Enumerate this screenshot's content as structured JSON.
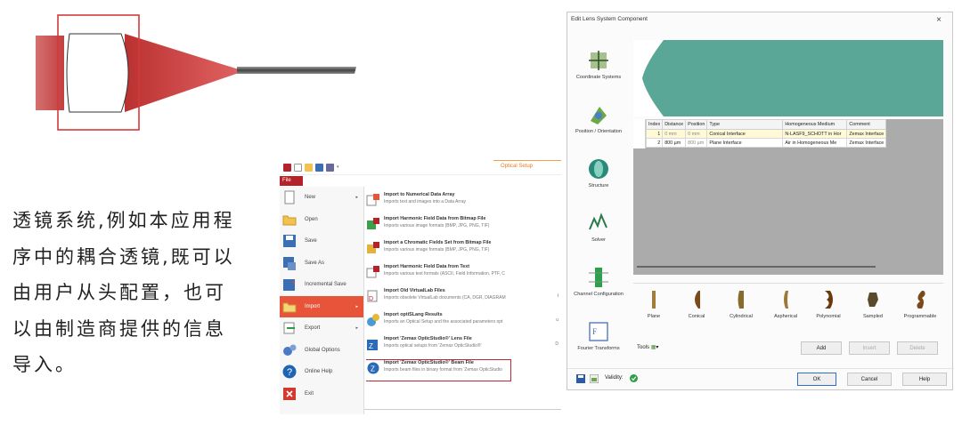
{
  "intro_text": "透镜系统,例如本应用程序中的耦合透镜,既可以由用户从头配置，也可以由制造商提供的信息导入。",
  "colors": {
    "lens_frame": "#d33a3a",
    "beam": "#b31a1a",
    "accent_red": "#c0283a",
    "canvas_green": "#5aa797"
  },
  "file_menu": {
    "ribbon_tab": "Optical Setup",
    "file_tab": "File",
    "left_items": [
      {
        "label": "New",
        "icon": "new-document-icon",
        "has_submenu": true
      },
      {
        "label": "Open",
        "icon": "folder-open-icon",
        "has_submenu": false
      },
      {
        "label": "Save",
        "icon": "save-disk-icon",
        "has_submenu": false
      },
      {
        "label": "Save As",
        "icon": "save-as-icon",
        "has_submenu": false
      },
      {
        "label": "Incremental Save",
        "icon": "incremental-save-icon",
        "has_submenu": false
      },
      {
        "label": "Import",
        "icon": "import-icon",
        "has_submenu": true,
        "active": true
      },
      {
        "label": "Export",
        "icon": "export-icon",
        "has_submenu": true
      },
      {
        "label": "Global Options",
        "icon": "gears-icon",
        "has_submenu": false
      },
      {
        "label": "Online Help",
        "icon": "help-icon",
        "has_submenu": false
      },
      {
        "label": "Exit",
        "icon": "exit-icon",
        "has_submenu": false
      }
    ],
    "right_items": [
      {
        "title": "Import to Numerical Data Array",
        "desc": "Imports text and images into a Data Array",
        "shortcut": ""
      },
      {
        "title": "Import Harmonic Field Data from Bitmap File",
        "desc": "Imports various image formats (BMP, JPG, PNG, TIF)",
        "shortcut": ""
      },
      {
        "title": "Import a Chromatic Fields Set from Bitmap File",
        "desc": "Imports various image formats (BMP, JPG, PNG, TIF)",
        "shortcut": ""
      },
      {
        "title": "Import Harmonic Field Data from Text",
        "desc": "Imports various text formats (ASCII, Field Information, PTF, C",
        "shortcut": ""
      },
      {
        "title": "Import Old VirtualLab Files",
        "desc": "Imports obsolete VirtualLab documents (CA, DGR, DIAGRAM",
        "shortcut": "t"
      },
      {
        "title": "Import optiSLang Results",
        "desc": "Imports an Optical Setup and the associated parameters opt",
        "shortcut": "u"
      },
      {
        "title": "Import 'Zemax OpticStudio®' Lens File",
        "desc": "Imports optical setups from 'Zemax OpticStudio®'",
        "shortcut": "D"
      },
      {
        "title": "Import 'Zemax OpticStudio®' Beam File",
        "desc": "Imports beam files in binary format from 'Zemax OpticStudio",
        "shortcut": ""
      }
    ]
  },
  "dialog": {
    "title": "Edit Lens System Component",
    "close": "×",
    "sidebar": [
      {
        "label": "Coordinate Systems",
        "icon": "coordinate-systems-icon"
      },
      {
        "label": "Position / Orientation",
        "icon": "position-orientation-icon"
      },
      {
        "label": "Structure",
        "icon": "structure-icon"
      },
      {
        "label": "Solver",
        "icon": "solver-icon"
      },
      {
        "label": "Channel Configuration",
        "icon": "channel-configuration-icon"
      },
      {
        "label": "Fourier Transforms",
        "icon": "fourier-transforms-icon"
      }
    ],
    "table": {
      "headers": [
        "Index",
        "Distance",
        "Position",
        "Type",
        "Homogeneous Medium",
        "Comment"
      ],
      "rows": [
        [
          "1",
          "0 mm",
          "0 mm",
          "Conical Interface",
          "N-LASF9_SCHOTT in Hor",
          "Zemax Interface"
        ],
        [
          "2",
          "800 µm",
          "800 µm",
          "Plane Interface",
          "Air in Homogeneous Me",
          "Zemax Interface"
        ]
      ]
    },
    "palette": [
      "Plane",
      "Conical",
      "Cylindrical",
      "Aspherical",
      "Polynomial",
      "Sampled",
      "Programmable"
    ],
    "tools_label": "Tools",
    "buttons": {
      "add": "Add",
      "insert": "Insert",
      "delete": "Delete",
      "ok": "OK",
      "cancel": "Cancel",
      "help": "Help"
    },
    "validity_label": "Validity:"
  }
}
